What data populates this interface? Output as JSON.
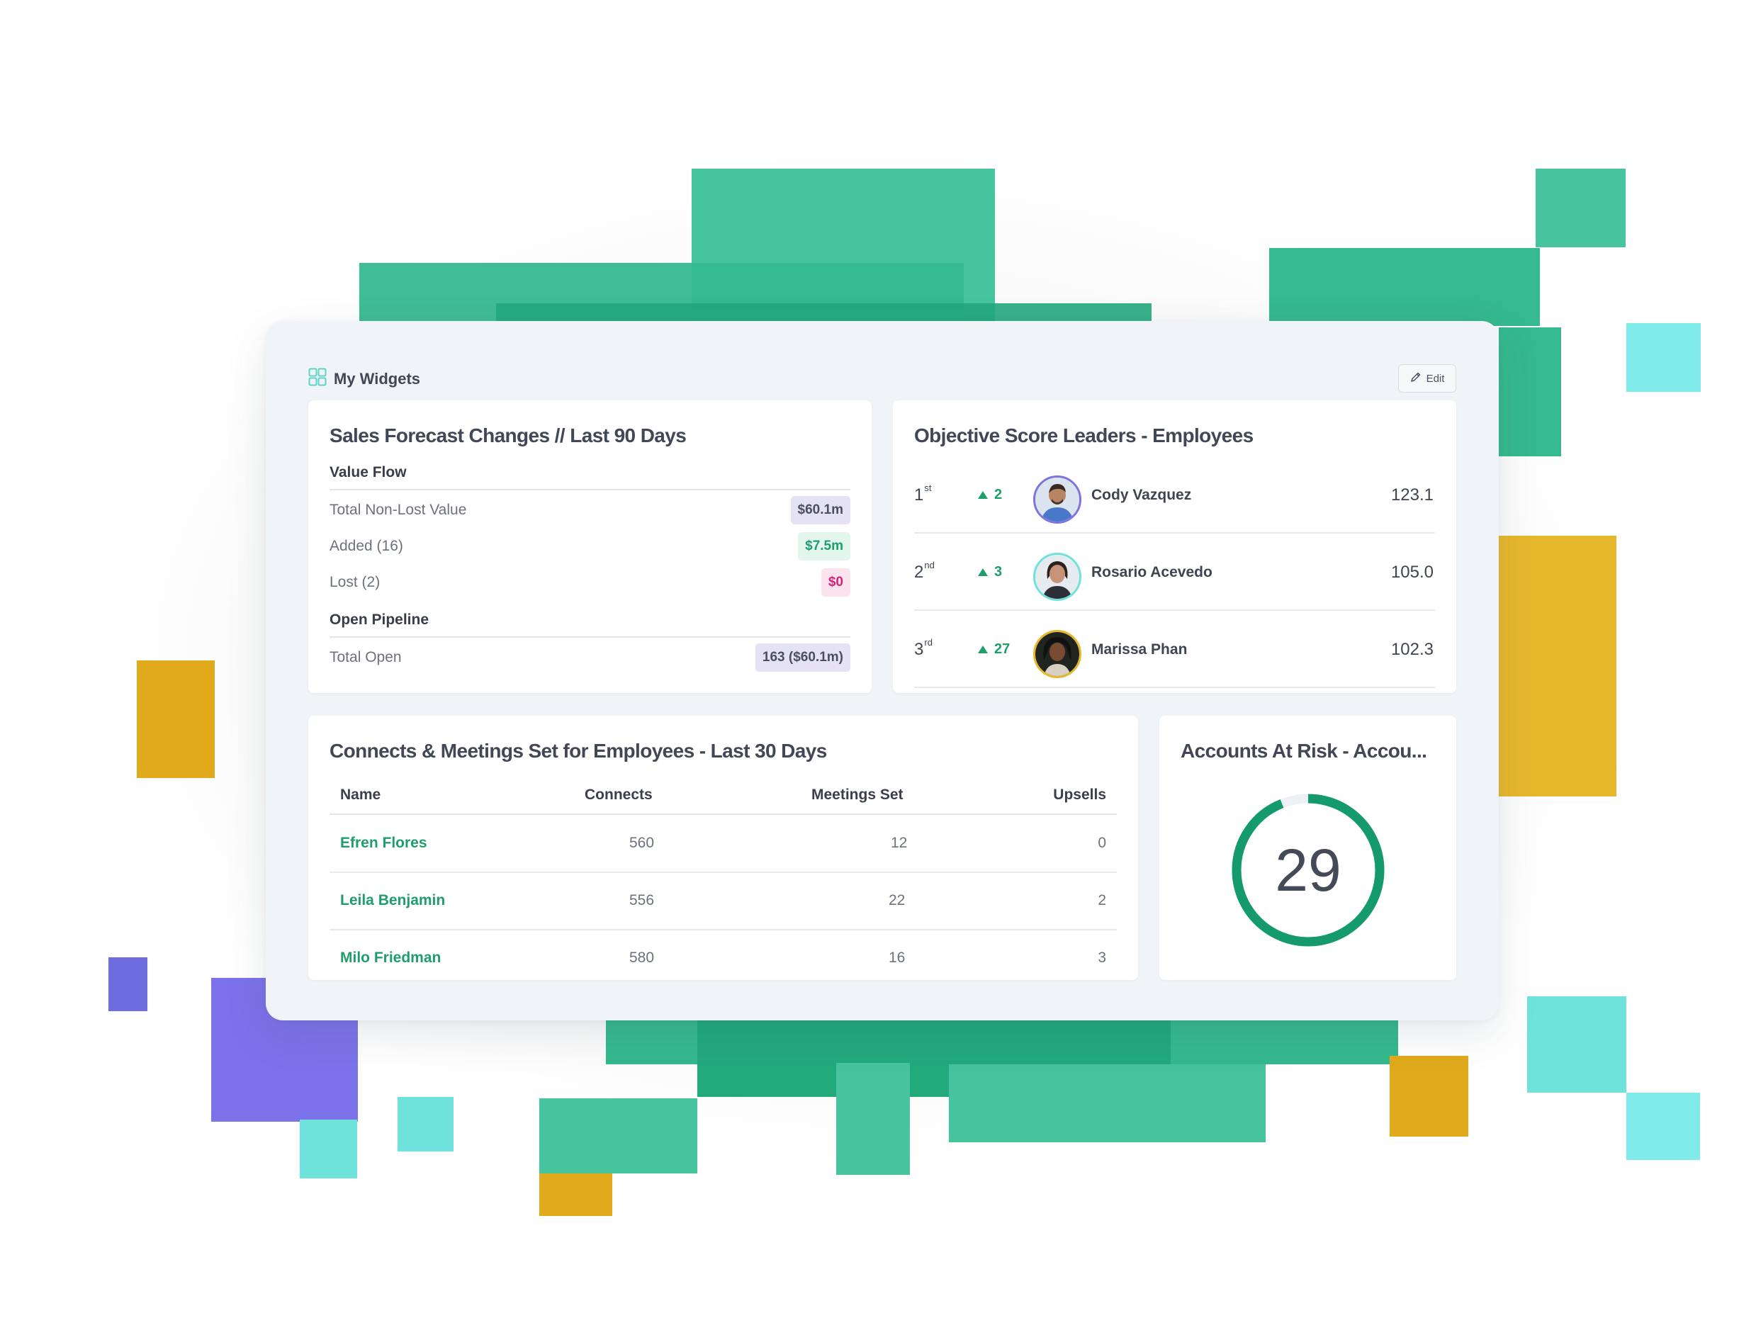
{
  "header": {
    "title": "My Widgets",
    "edit_label": "Edit"
  },
  "sales_forecast": {
    "title": "Sales Forecast Changes // Last 90 Days",
    "value_flow": {
      "heading": "Value Flow",
      "rows": [
        {
          "label": "Total Non-Lost Value",
          "value": "$60.1m"
        },
        {
          "label": "Added (16)",
          "value": "$7.5m"
        },
        {
          "label": "Lost (2)",
          "value": "$0"
        }
      ]
    },
    "open_pipeline": {
      "heading": "Open Pipeline",
      "rows": [
        {
          "label": "Total Open",
          "value": "163 ($60.1m)"
        }
      ]
    }
  },
  "leaders": {
    "title": "Objective Score Leaders - Employees",
    "rows": [
      {
        "rank": "1",
        "suffix": "st",
        "delta": "2",
        "name": "Cody Vazquez",
        "score": "123.1"
      },
      {
        "rank": "2",
        "suffix": "nd",
        "delta": "3",
        "name": "Rosario Acevedo",
        "score": "105.0"
      },
      {
        "rank": "3",
        "suffix": "rd",
        "delta": "27",
        "name": "Marissa Phan",
        "score": "102.3"
      }
    ]
  },
  "connects": {
    "title": "Connects & Meetings Set for Employees - Last 30 Days",
    "columns": [
      "Name",
      "Connects",
      "Meetings Set",
      "Upsells"
    ],
    "rows": [
      {
        "name": "Efren Flores",
        "connects": "560",
        "meetings": "12",
        "upsells": "0"
      },
      {
        "name": "Leila Benjamin",
        "connects": "556",
        "meetings": "22",
        "upsells": "2"
      },
      {
        "name": "Milo Friedman",
        "connects": "580",
        "meetings": "16",
        "upsells": "3"
      }
    ]
  },
  "accounts_at_risk": {
    "title": "Accounts At Risk - Accou...",
    "value": "29",
    "fill_fraction": 0.94
  },
  "colors": {
    "accent_green": "#1f9e6c",
    "pink": "#d4237a",
    "lavender_pill": "#e6e2f6",
    "avatar_ring_purple": "#7d72e0",
    "avatar_ring_teal": "#6fe2dc",
    "avatar_ring_yellow": "#e7b82c"
  }
}
